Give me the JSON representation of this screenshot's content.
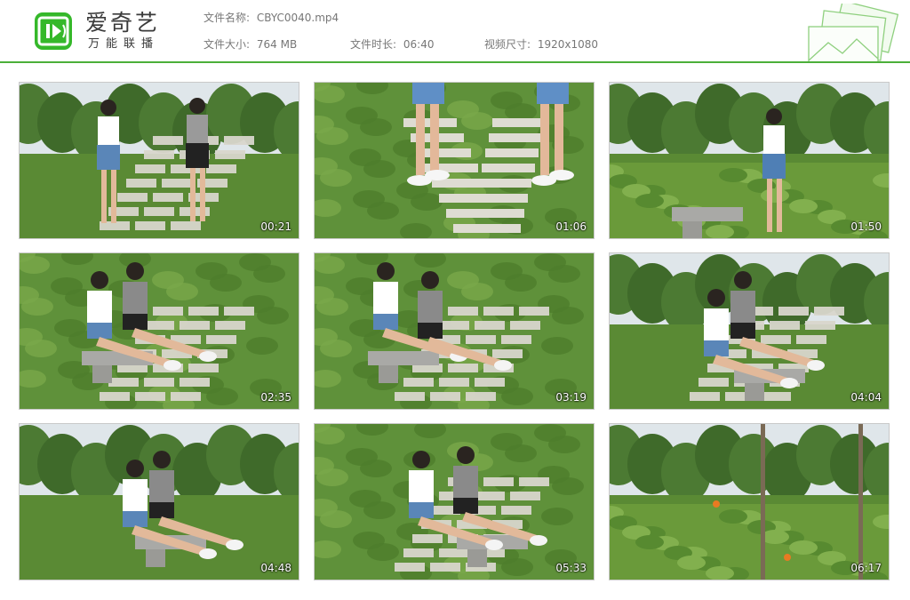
{
  "brand": {
    "title": "爱奇艺",
    "subtitle": "万能联播",
    "color": "#35b82a"
  },
  "file": {
    "name_label": "文件名称:",
    "name_value": "CBYC0040.mp4",
    "size_label": "文件大小:",
    "size_value": "764 MB",
    "duration_label": "文件时长:",
    "duration_value": "06:40",
    "dims_label": "视频尺寸:",
    "dims_value": "1920x1080"
  },
  "thumbnails": [
    {
      "timestamp": "00:21"
    },
    {
      "timestamp": "01:06"
    },
    {
      "timestamp": "01:50"
    },
    {
      "timestamp": "02:35"
    },
    {
      "timestamp": "03:19"
    },
    {
      "timestamp": "04:04"
    },
    {
      "timestamp": "04:48"
    },
    {
      "timestamp": "05:33"
    },
    {
      "timestamp": "06:17"
    }
  ],
  "colors": {
    "accent": "#4caf3a",
    "grass": "#5f8f3a",
    "sky": "#e8ecef"
  }
}
